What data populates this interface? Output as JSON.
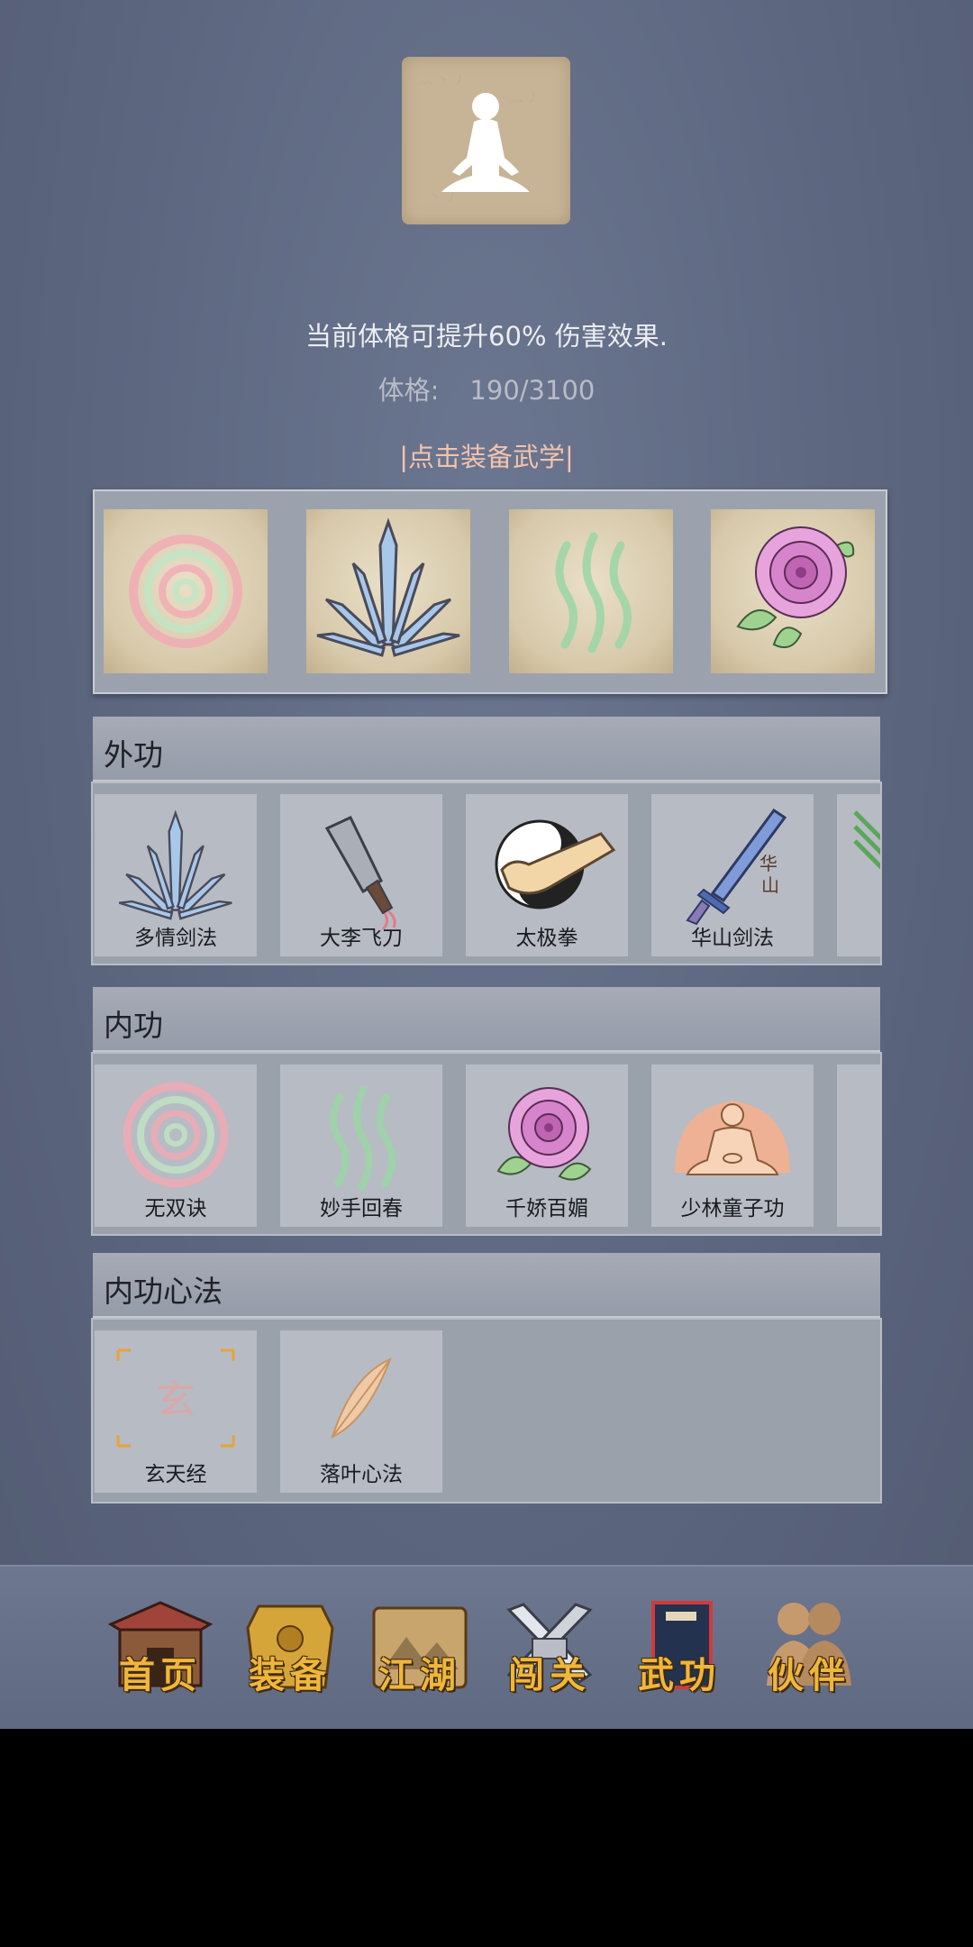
{
  "header": {
    "meditation_icon": "meditation-figure-icon",
    "description": "当前体格可提升60% 伤害效果.",
    "stat_label": "体格:",
    "stat_value": "190/3100",
    "equip_hint": "|点击装备武学|"
  },
  "equipped": [
    {
      "icon": "spiral-icon"
    },
    {
      "icon": "sword-fan-icon"
    },
    {
      "icon": "green-wisps-icon"
    },
    {
      "icon": "peony-icon"
    }
  ],
  "sections": {
    "outer": {
      "title": "外功",
      "items": [
        {
          "name": "多情剑法",
          "icon": "sword-fan-icon"
        },
        {
          "name": "大李飞刀",
          "icon": "cleaver-icon"
        },
        {
          "name": "太极拳",
          "icon": "taiji-fist-icon"
        },
        {
          "name": "华山剑法",
          "icon": "huashan-sword-icon"
        }
      ],
      "partial_icon": "green-blades-icon"
    },
    "inner": {
      "title": "内功",
      "items": [
        {
          "name": "无双诀",
          "icon": "spiral-icon"
        },
        {
          "name": "妙手回春",
          "icon": "green-wisps-icon"
        },
        {
          "name": "千娇百媚",
          "icon": "peony-icon"
        },
        {
          "name": "少林童子功",
          "icon": "monk-seated-icon"
        }
      ]
    },
    "heart": {
      "title": "内功心法",
      "items": [
        {
          "name": "玄天经",
          "icon": "xuan-scroll-icon"
        },
        {
          "name": "落叶心法",
          "icon": "feather-leaf-icon"
        }
      ]
    }
  },
  "nav": [
    {
      "label": "首页",
      "icon": "house-icon"
    },
    {
      "label": "装备",
      "icon": "armor-icon"
    },
    {
      "label": "江湖",
      "icon": "scroll-map-icon"
    },
    {
      "label": "闯关",
      "icon": "crossed-swords-icon"
    },
    {
      "label": "武功",
      "icon": "book-icon"
    },
    {
      "label": "伙伴",
      "icon": "partners-icon"
    }
  ],
  "colors": {
    "background": "#5c667f",
    "hint_text": "#f2c4ad",
    "nav_label": "#f0b63a",
    "parchment": "#d7c9aa"
  }
}
